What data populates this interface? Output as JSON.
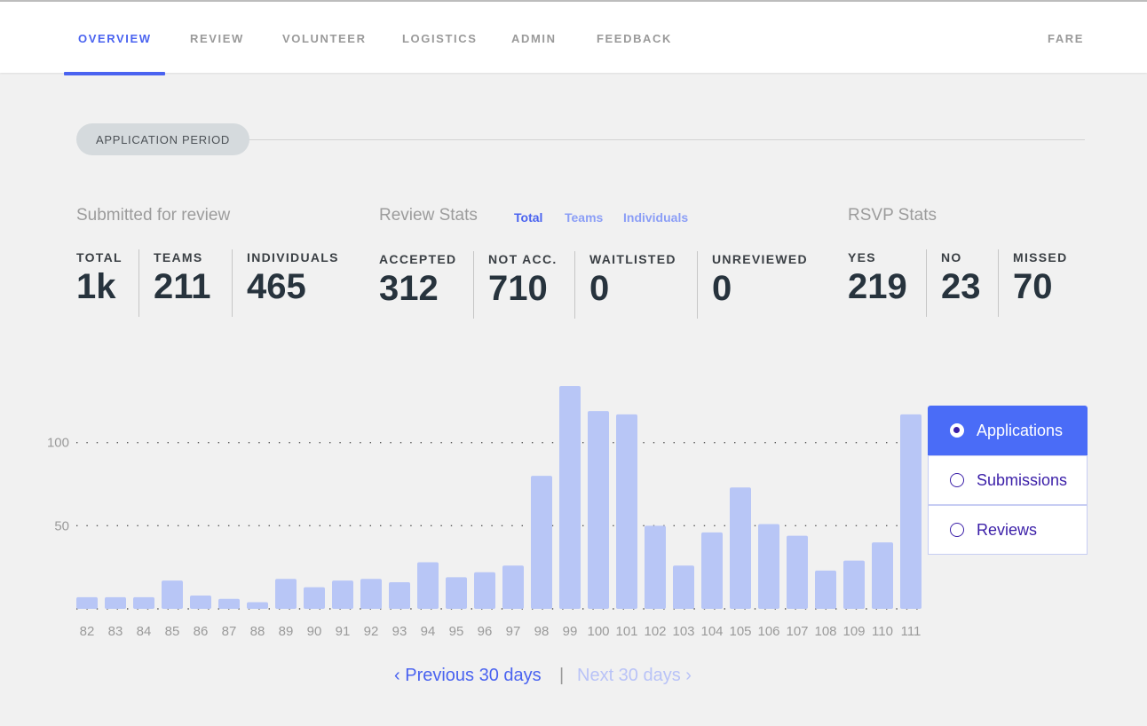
{
  "nav": {
    "items": [
      "OVERVIEW",
      "REVIEW",
      "VOLUNTEER",
      "LOGISTICS",
      "ADMIN",
      "FEEDBACK"
    ],
    "active": "OVERVIEW",
    "right": "FARE",
    "accent": "#4a63f0"
  },
  "period": {
    "label": "APPLICATION PERIOD"
  },
  "submitted": {
    "title": "Submitted for review",
    "stats": [
      {
        "label": "TOTAL",
        "value": "1k"
      },
      {
        "label": "TEAMS",
        "value": "211"
      },
      {
        "label": "INDIVIDUALS",
        "value": "465"
      }
    ]
  },
  "review": {
    "title": "Review Stats",
    "toggles": [
      "Total",
      "Teams",
      "Individuals"
    ],
    "active_toggle": "Total",
    "stats": [
      {
        "label": "ACCEPTED",
        "value": "312"
      },
      {
        "label": "NOT ACC.",
        "value": "710"
      },
      {
        "label": "WAITLISTED",
        "value": "0"
      },
      {
        "label": "UNREVIEWED",
        "value": "0"
      }
    ]
  },
  "rsvp": {
    "title": "RSVP Stats",
    "stats": [
      {
        "label": "YES",
        "value": "219"
      },
      {
        "label": "NO",
        "value": "23"
      },
      {
        "label": "MISSED",
        "value": "70"
      }
    ]
  },
  "chart_data": {
    "type": "bar",
    "categories": [
      "82",
      "83",
      "84",
      "85",
      "86",
      "87",
      "88",
      "89",
      "90",
      "91",
      "92",
      "93",
      "94",
      "95",
      "96",
      "97",
      "98",
      "99",
      "100",
      "101",
      "102",
      "103",
      "104",
      "105",
      "106",
      "107",
      "108",
      "109",
      "110",
      "111"
    ],
    "values": [
      7,
      7,
      7,
      17,
      8,
      6,
      4,
      18,
      13,
      17,
      18,
      16,
      28,
      19,
      22,
      26,
      80,
      134,
      119,
      117,
      50,
      26,
      46,
      73,
      51,
      44,
      23,
      29,
      40,
      117
    ],
    "yticks": [
      50,
      100
    ],
    "ylim": [
      0,
      134
    ],
    "grid": "dotted horizontal",
    "bar_color": "#b8c6f6"
  },
  "chart_modes": {
    "options": [
      "Applications",
      "Submissions",
      "Reviews"
    ],
    "selected": "Applications"
  },
  "pager": {
    "prev": "Previous 30 days",
    "next": "Next 30 days",
    "separator": "|"
  }
}
